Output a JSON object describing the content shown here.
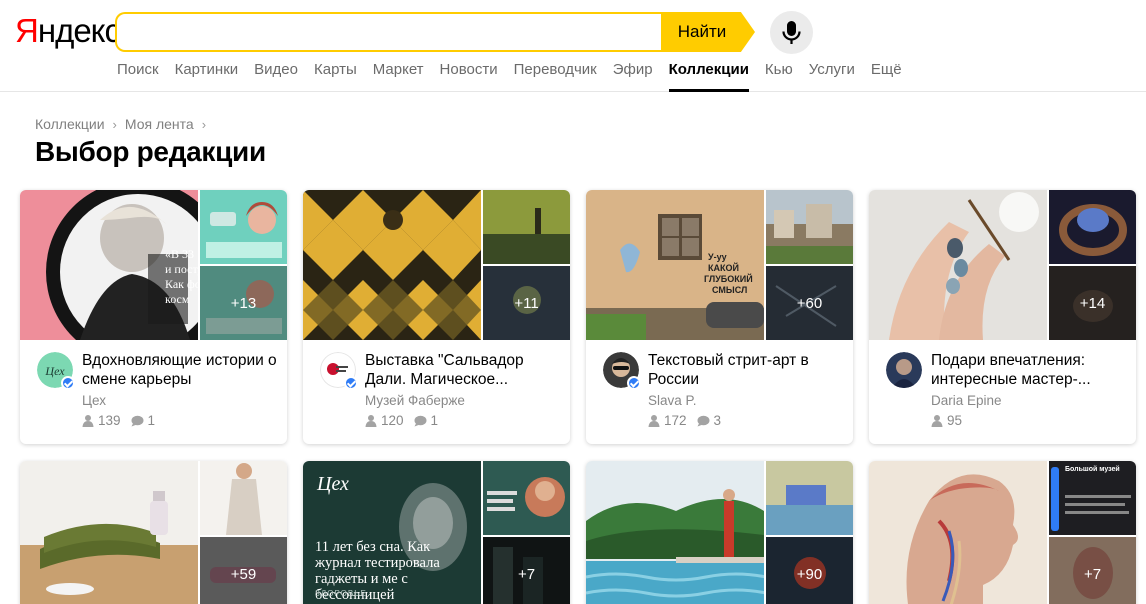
{
  "header": {
    "logo_first": "Я",
    "logo_rest": "ндекс",
    "search_value": "",
    "search_button": "Найти",
    "nav": [
      "Поиск",
      "Картинки",
      "Видео",
      "Карты",
      "Маркет",
      "Новости",
      "Переводчик",
      "Эфир",
      "Коллекции",
      "Кью",
      "Услуги",
      "Ещё"
    ],
    "active_nav": "Коллекции"
  },
  "breadcrumb": [
    "Коллекции",
    "Моя лента"
  ],
  "page_title": "Выбор редакции",
  "cards": [
    {
      "title": "Вдохновляющие истории о смене карьеры",
      "author": "Цех",
      "subscribers": "139",
      "comments": "1",
      "more": "+13",
      "verified": true
    },
    {
      "title": "Выставка \"Сальвадор Дали. Магическое...",
      "author": "Музей Фаберже",
      "subscribers": "120",
      "comments": "1",
      "more": "+11",
      "verified": true
    },
    {
      "title": "Текстовый стрит-арт в России",
      "author": "Slava P.",
      "subscribers": "172",
      "comments": "3",
      "more": "+60",
      "verified": true
    },
    {
      "title": "Подари впечатления: интересные мастер-...",
      "author": "Daria Epine",
      "subscribers": "95",
      "comments": "",
      "more": "+14",
      "verified": false
    }
  ],
  "cards_row2": [
    {
      "more": "+59"
    },
    {
      "more": "+7",
      "big_brand": "Цех",
      "big_headline": "11 лет без сна. Как журнал тестировала гаджеты и ме с бессонницей",
      "big_tag": "ЗДОРОВЬЕ"
    },
    {
      "more": "+90"
    },
    {
      "more": "+7",
      "brand": "Большой музей"
    }
  ],
  "colors": {
    "accent": "#ffcc00",
    "logo_red": "#ff0000",
    "verified": "#2f7cf6"
  }
}
